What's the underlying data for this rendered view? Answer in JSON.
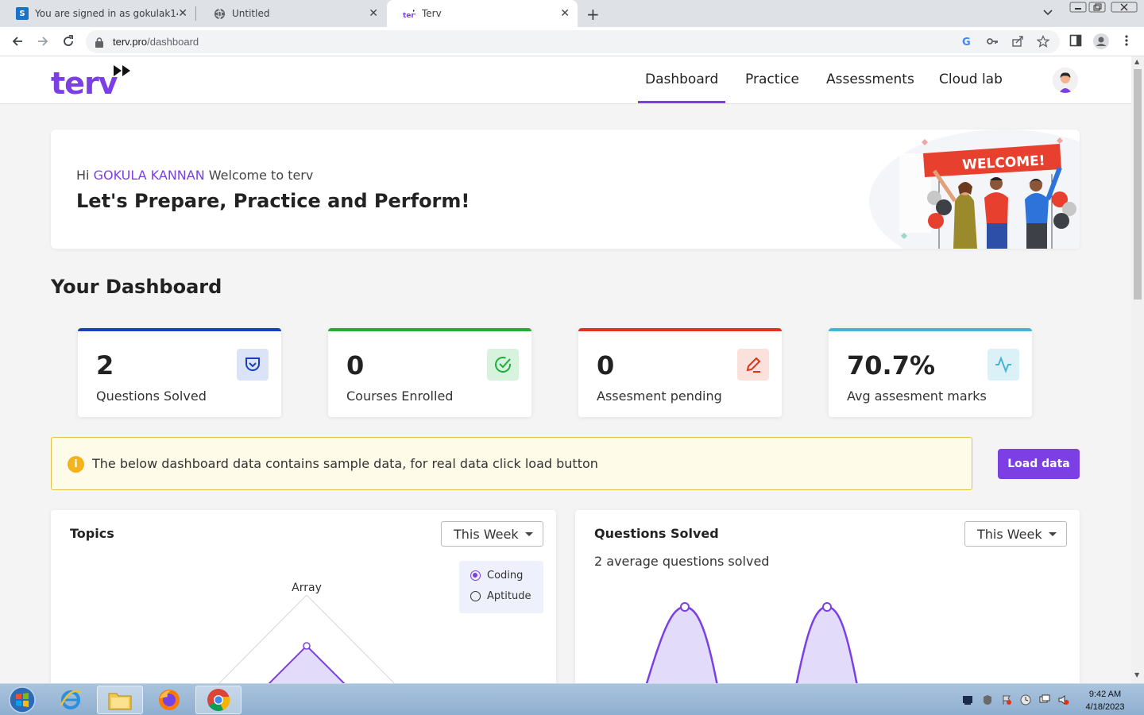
{
  "browser": {
    "tabs": [
      {
        "title": "You are signed in as gokulak1402",
        "favicon": "S"
      },
      {
        "title": "Untitled",
        "favicon": "globe-icon"
      },
      {
        "title": "Terv",
        "favicon": "terv-icon"
      }
    ],
    "url_host": "terv.pro",
    "url_path": "/dashboard"
  },
  "nav": {
    "logo": "terv",
    "links": [
      "Dashboard",
      "Practice",
      "Assessments",
      "Cloud lab"
    ],
    "active": "Dashboard"
  },
  "welcome": {
    "hi": "Hi",
    "user": "GOKULA KANNAN",
    "welcome_text": "Welcome to terv",
    "tagline": "Let's Prepare, Practice and Perform!",
    "banner": "WELCOME!"
  },
  "dashboard": {
    "title": "Your Dashboard",
    "stats": [
      {
        "value": "2",
        "label": "Questions Solved",
        "color": "#1b3fbf",
        "icon": "shield-icon"
      },
      {
        "value": "0",
        "label": "Courses Enrolled",
        "color": "#1fae3b",
        "icon": "check-circle-icon"
      },
      {
        "value": "0",
        "label": "Assesment pending",
        "color": "#d9361d",
        "icon": "pencil-icon"
      },
      {
        "value": "70.7%",
        "label": "Avg assesment marks",
        "color": "#45b5d6",
        "icon": "activity-icon"
      }
    ]
  },
  "notice": {
    "message": "The below dashboard data contains sample data, for real data click load button",
    "button": "Load data"
  },
  "topics": {
    "title": "Topics",
    "period": "This Week",
    "legend": [
      "Coding",
      "Aptitude"
    ],
    "selected": "Coding",
    "axis_label": "Array"
  },
  "questions": {
    "title": "Questions Solved",
    "period": "This Week",
    "summary": "2 average questions solved"
  },
  "taskbar": {
    "time": "9:42 AM",
    "date": "4/18/2023"
  },
  "colors": {
    "accent": "#7b3fe4",
    "notice_bg": "#fffbe9",
    "notice_border": "#e6c046"
  }
}
